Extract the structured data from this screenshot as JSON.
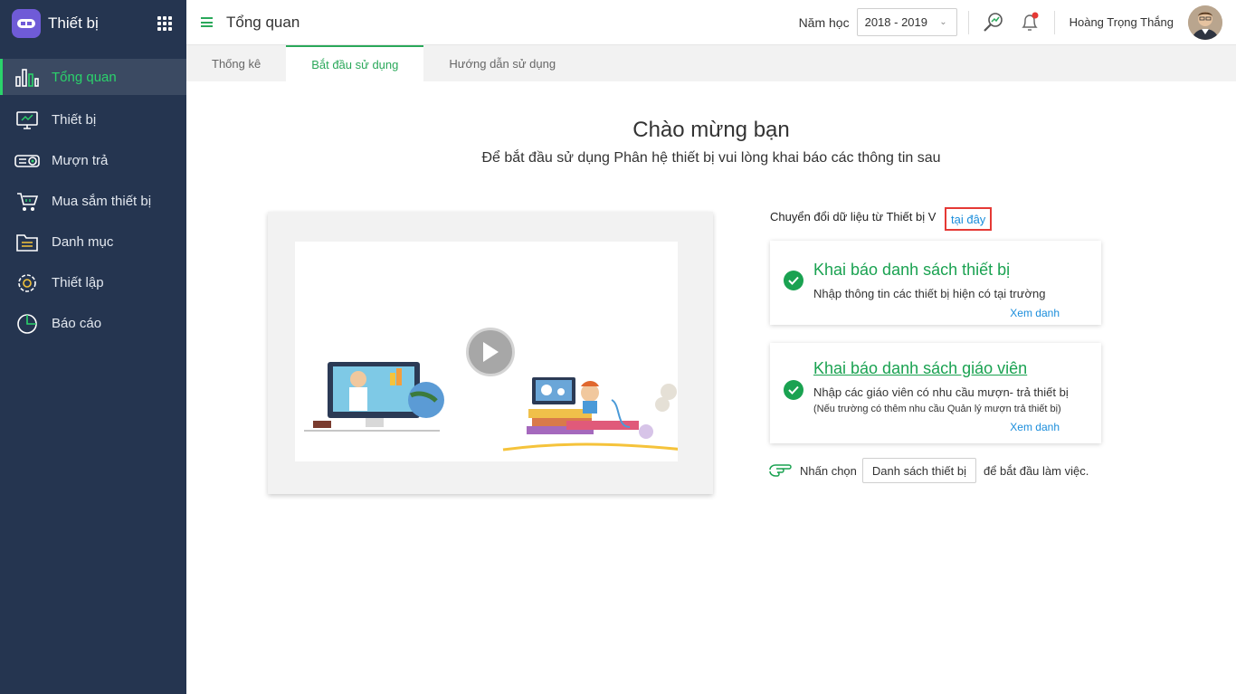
{
  "brand": {
    "title": "Thiết bị"
  },
  "sidebar": {
    "items": [
      {
        "label": "Tổng quan",
        "icon": "bar-chart-icon",
        "active": true
      },
      {
        "label": "Thiết bị",
        "icon": "monitor-icon"
      },
      {
        "label": "Mượn trả",
        "icon": "projector-icon"
      },
      {
        "label": "Mua sắm thiết bị",
        "icon": "cart-icon"
      },
      {
        "label": "Danh mục",
        "icon": "folder-icon"
      },
      {
        "label": "Thiết lập",
        "icon": "gear-icon"
      },
      {
        "label": "Báo cáo",
        "icon": "pie-chart-icon"
      }
    ]
  },
  "header": {
    "title": "Tổng quan",
    "year_label": "Năm học",
    "year_value": "2018 - 2019",
    "user_name": "Hoàng Trọng  Thắng"
  },
  "tabs": [
    {
      "label": "Thống kê"
    },
    {
      "label": "Bắt đầu sử dụng",
      "active": true
    },
    {
      "label": "Hướng dẫn sử dụng"
    }
  ],
  "main": {
    "welcome": "Chào mừng bạn",
    "subtitle": "Để bắt đầu sử dụng Phân hệ thiết bị vui lòng khai báo các thông tin sau",
    "convert_text": "Chuyển đổi dữ liệu từ Thiết bị V",
    "convert_link": "tại đây",
    "card1": {
      "title": "Khai báo danh sách thiết bị",
      "desc": "Nhập thông tin các thiết bị hiện có tại trường",
      "link": "Xem danh"
    },
    "card2": {
      "title": "Khai báo danh sách giáo viên",
      "desc": "Nhập các giáo viên có nhu cầu mượn- trả thiết bị",
      "note": "(Nếu trường có thêm nhu cầu Quản lý mượn trả thiết bị)",
      "link": "Xem danh"
    },
    "hint_prefix": "Nhấn chọn",
    "hint_button": "Danh sách thiết bị",
    "hint_suffix": "để bắt đầu làm việc."
  },
  "colors": {
    "accent": "#2aa85a",
    "sidebar": "#253550",
    "link": "#1a8ddb",
    "highlight": "#e53935"
  }
}
